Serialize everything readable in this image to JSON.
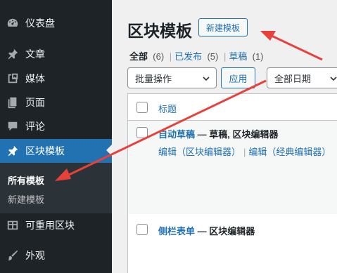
{
  "sidebar": {
    "items": [
      {
        "label": "仪表盘",
        "icon": "dashboard-icon"
      },
      {
        "label": "文章",
        "icon": "pin-icon"
      },
      {
        "label": "媒体",
        "icon": "media-icon"
      },
      {
        "label": "页面",
        "icon": "page-icon"
      },
      {
        "label": "评论",
        "icon": "comment-icon"
      },
      {
        "label": "区块模板",
        "icon": "pin-icon"
      },
      {
        "label": "可重用区块",
        "icon": "table-icon"
      },
      {
        "label": "外观",
        "icon": "brush-icon"
      }
    ],
    "submenu": {
      "current": "所有模板",
      "add_new": "新建模板"
    }
  },
  "main": {
    "title": "区块模板",
    "add_new_button": "新建模板",
    "filters": {
      "all_label": "全部",
      "all_count": "(6)",
      "published_label": "已发布",
      "published_count": "(5)",
      "draft_label": "草稿",
      "draft_count": "(1)",
      "separator": "|"
    },
    "bulk_actions": "批量操作",
    "apply_button": "应用",
    "date_filter": "全部日期",
    "table": {
      "column_title": "标题",
      "rows": [
        {
          "title": "自动草稿",
          "state": " — 草稿, 区块编辑器",
          "action_block_editor": "编辑（区块编辑器）",
          "action_classic_editor": "编辑（经典编辑器）",
          "action_separator": "|"
        },
        {
          "title": "侧栏表单",
          "state": " — 区块编辑器"
        }
      ]
    }
  },
  "colors": {
    "sidebar_bg": "#1d2327",
    "active": "#2271b1",
    "link": "#2271b1",
    "annotation_arrow": "#e8413b"
  }
}
